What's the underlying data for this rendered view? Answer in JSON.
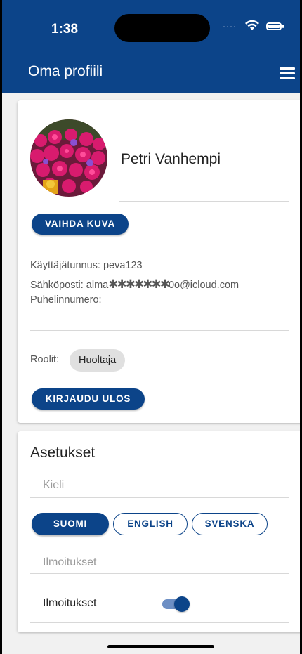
{
  "status_bar": {
    "time": "1:38"
  },
  "header": {
    "title": "Oma profiili"
  },
  "profile": {
    "name": "Petri Vanhempi",
    "change_photo_label": "VAIHDA KUVA",
    "username_line": "Käyttäjätunnus: peva123",
    "email_prefix": "Sähköposti: alma",
    "email_mask": "✱✱✱✱✱✱✱",
    "email_suffix": "0o@icloud.com",
    "phone_line": "Puhelinnumero:",
    "roles_label": "Roolit:",
    "roles": [
      "Huoltaja"
    ],
    "logout_label": "KIRJAUDU ULOS"
  },
  "settings": {
    "title": "Asetukset",
    "language_label": "Kieli",
    "languages": [
      "SUOMI",
      "ENGLISH",
      "SVENSKA"
    ],
    "selected_language": "SUOMI",
    "notifications_section_label": "Ilmoitukset",
    "notifications_toggle_label": "Ilmoitukset",
    "notifications_enabled": true
  },
  "colors": {
    "primary": "#0c4489",
    "background": "#f1f1f1",
    "chip": "#e0e0e0"
  }
}
